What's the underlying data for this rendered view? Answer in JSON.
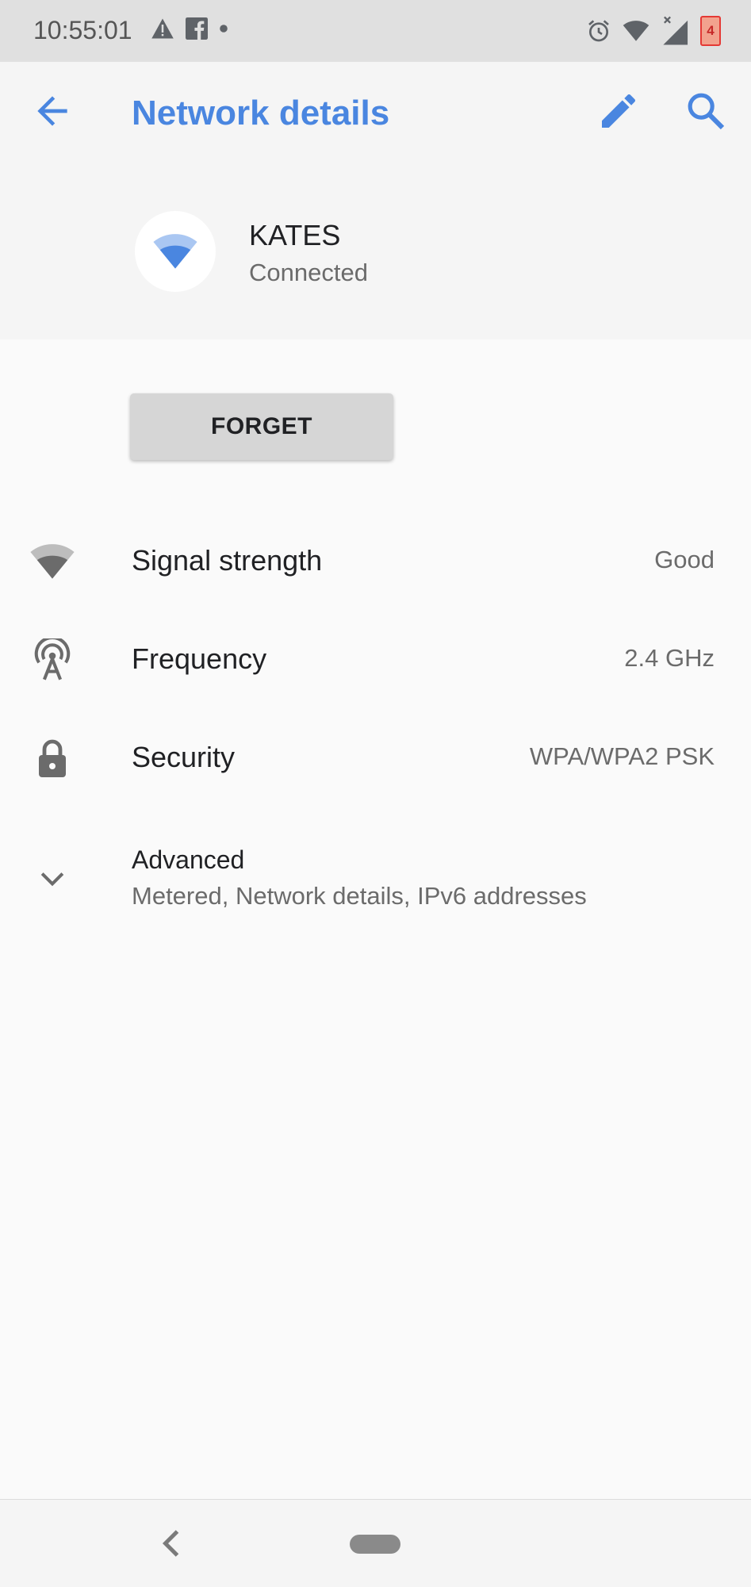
{
  "status_bar": {
    "time": "10:55:01",
    "left_icons": [
      "warning-icon",
      "facebook-icon",
      "dot-icon"
    ],
    "right_icons": [
      "alarm-icon",
      "wifi-icon",
      "cell-signal-icon",
      "battery-icon"
    ],
    "battery_level_text": "4",
    "battery_color": "#e53935"
  },
  "app_bar": {
    "title": "Network details",
    "accent_color": "#4a86e0"
  },
  "network": {
    "name": "KATES",
    "status": "Connected"
  },
  "actions": {
    "forget_label": "FORGET"
  },
  "details": [
    {
      "label": "Signal strength",
      "value": "Good",
      "icon": "wifi-signal-icon"
    },
    {
      "label": "Frequency",
      "value": "2.4 GHz",
      "icon": "antenna-icon"
    },
    {
      "label": "Security",
      "value": "WPA/WPA2 PSK",
      "icon": "lock-icon"
    }
  ],
  "advanced": {
    "label": "Advanced",
    "summary": "Metered, Network details, IPv6 addresses"
  }
}
